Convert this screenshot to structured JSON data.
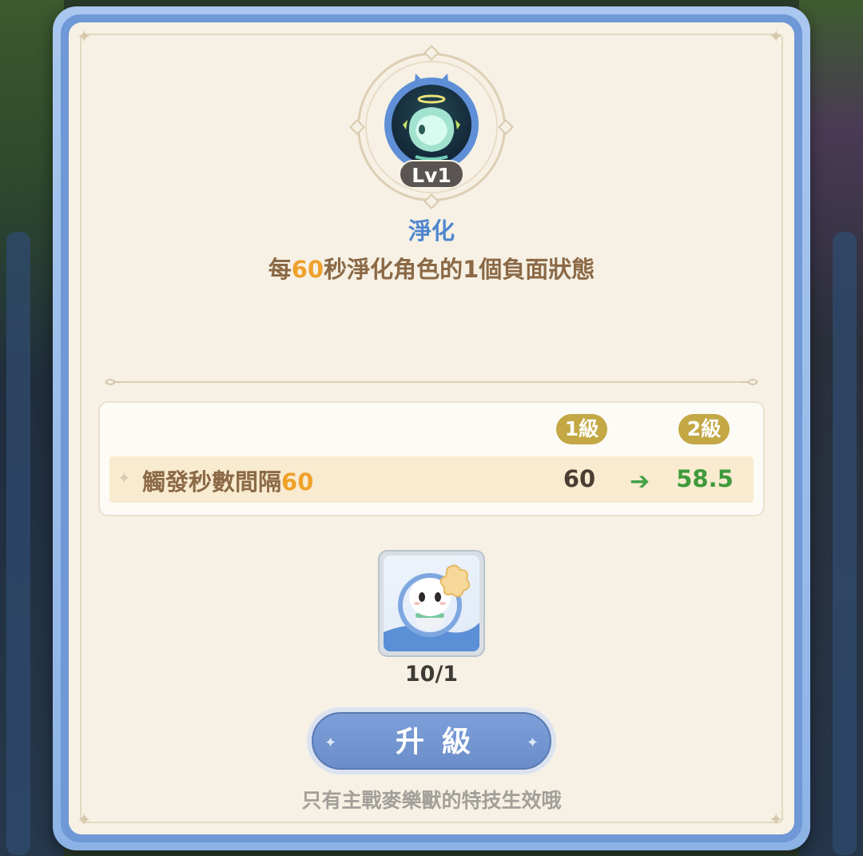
{
  "skill": {
    "level_badge": "Lv1",
    "name": "淨化",
    "description": {
      "prefix": "每",
      "highlight": "60",
      "suffix": "秒淨化角色的1個負面狀態"
    }
  },
  "stats": {
    "current_level_label": "1級",
    "next_level_label": "2級",
    "rows": [
      {
        "label": "觸發秒數間隔",
        "label_value": "60",
        "current": "60",
        "next": "58.5"
      }
    ]
  },
  "material": {
    "icon": "white-mascot-icon",
    "count": "10/1"
  },
  "upgrade_button": {
    "label": "升級"
  },
  "footnote": "只有主戰麥樂獸的特技生效哦",
  "colors": {
    "title_blue": "#4f86cf",
    "text_brown": "#8b6946",
    "highlight_orange": "#f0a12a",
    "next_value_green": "#3f9a3b",
    "button_blue": "#6b8dc9",
    "level_pill_gold": "#c3a845"
  }
}
